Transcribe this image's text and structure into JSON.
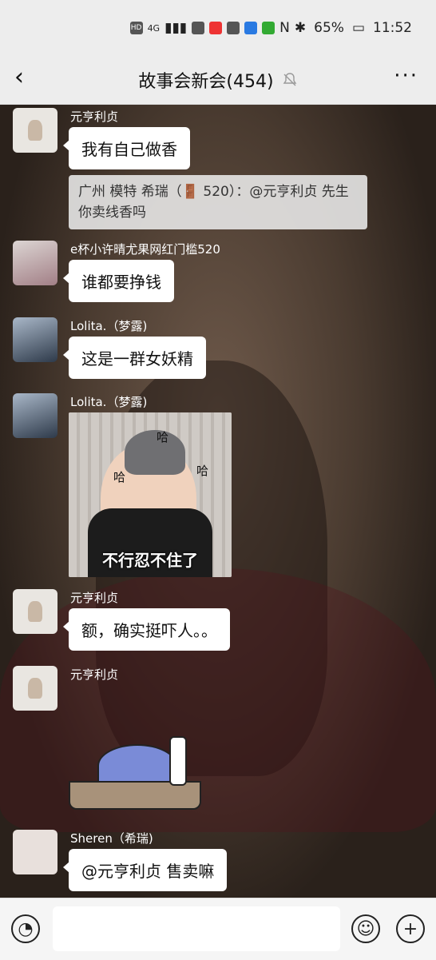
{
  "status": {
    "network": "4G",
    "battery": "65%",
    "time": "11:52"
  },
  "header": {
    "title": "故事会新会(454)",
    "back_icon": "chevron-left-icon",
    "more_icon": "more-icon",
    "mute_icon": "bell-off-icon"
  },
  "messages": [
    {
      "sender": "元亨利贞",
      "text": "我有自己做香"
    },
    {
      "quote": "广州 模特 希瑞（🚪 520）：@元亨利贞 先生你卖线香吗"
    },
    {
      "sender": "e杯小许晴尤果网红门槛520",
      "text": "谁都要挣钱"
    },
    {
      "sender": "Lolita.（梦露)",
      "text": "这是一群女妖精"
    },
    {
      "sender": "Lolita.（梦露)",
      "meme_text": "不行忍不住了",
      "meme_ha1": "哈",
      "meme_ha2": "哈",
      "meme_ha3": "哈"
    },
    {
      "sender": "元亨利贞",
      "text": "额，确实挺吓人。。"
    },
    {
      "sender": "元亨利贞",
      "sticker": "sticker-icon"
    },
    {
      "sender": "Sheren（希瑞)",
      "text": "@元亨利贞  售卖嘛"
    }
  ],
  "bottom": {
    "voice_icon": "voice-icon",
    "emoji_icon": "emoji-icon",
    "plus_icon": "plus-icon"
  }
}
